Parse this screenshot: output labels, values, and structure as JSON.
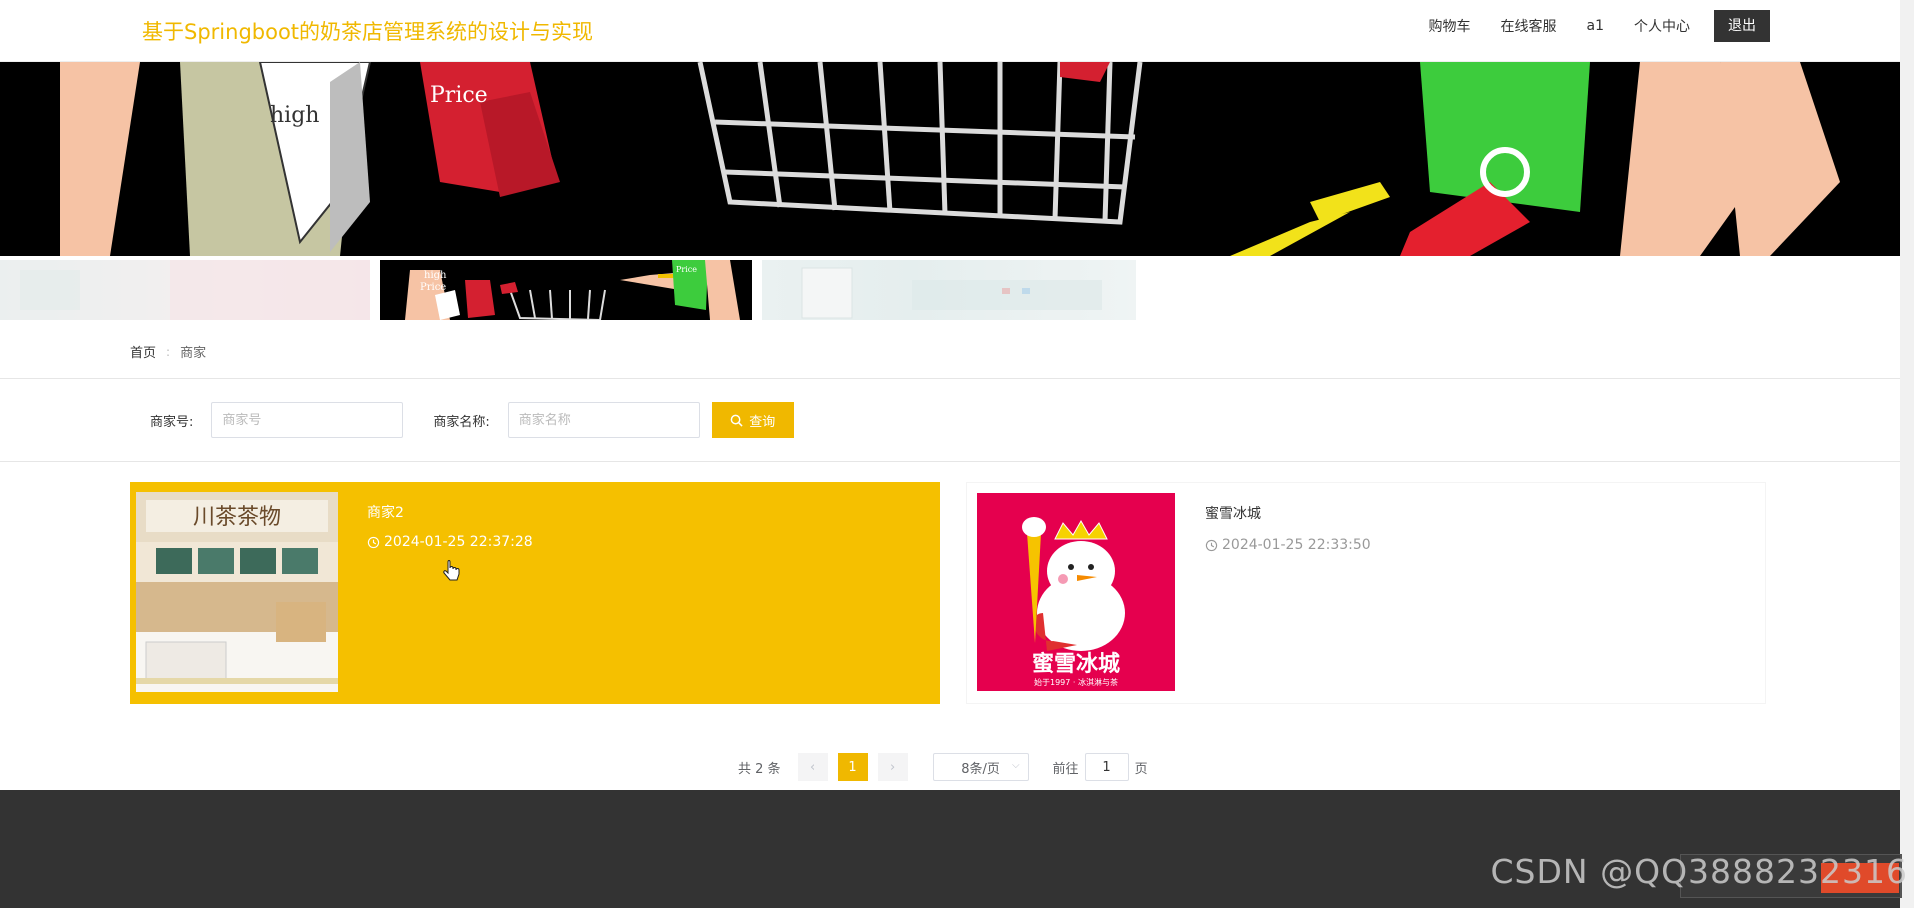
{
  "header": {
    "title": "基于Springboot的奶茶店管理系统的设计与实现",
    "nav": [
      "购物车",
      "在线客服",
      "a1",
      "个人中心"
    ],
    "logout_label": "退出"
  },
  "banner": {
    "main_text": [
      "high",
      "Price"
    ],
    "thumb_text": [
      "high",
      "Price",
      "Price"
    ]
  },
  "breadcrumb": {
    "home": "首页",
    "separator": ":",
    "current": "商家"
  },
  "search": {
    "merchant_no_label": "商家号:",
    "merchant_no_placeholder": "商家号",
    "merchant_name_label": "商家名称:",
    "merchant_name_placeholder": "商家名称",
    "button_label": "查询"
  },
  "merchants": [
    {
      "name": "商家2",
      "time": "2024-01-25 22:37:28",
      "sign_text": "川茶茶物"
    },
    {
      "name": "蜜雪冰城",
      "time": "2024-01-25 22:33:50",
      "logo_text": "蜜雪冰城",
      "logo_subtext": "始于1997 · 冰淇淋与茶"
    }
  ],
  "pagination": {
    "total": "共 2 条",
    "prev": "‹",
    "current": "1",
    "next": "›",
    "page_size": "8条/页",
    "goto_prefix": "前往",
    "goto_value": "1",
    "goto_suffix": "页"
  },
  "watermark": "CSDN @QQ3888232316",
  "colors": {
    "accent": "#f0b800",
    "footer": "#333333",
    "header_title": "#f0b800"
  }
}
